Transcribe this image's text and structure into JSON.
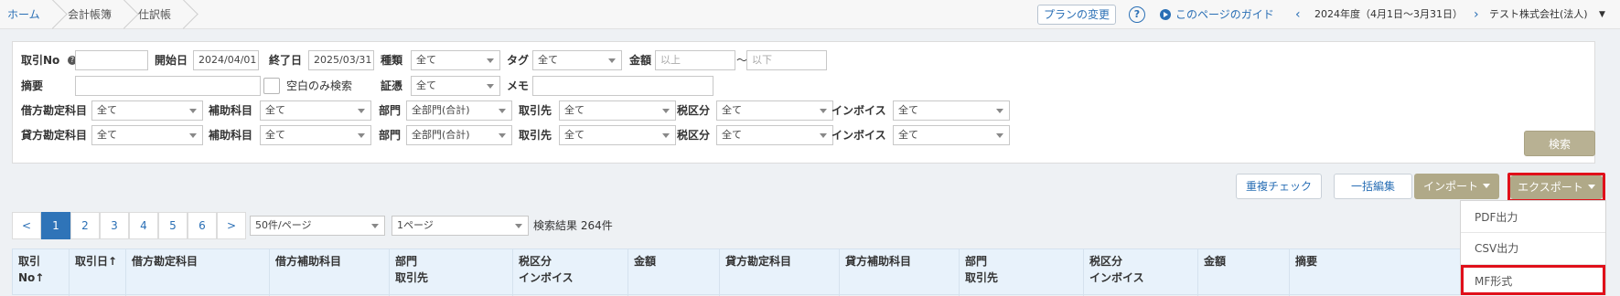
{
  "breadcrumb": [
    "ホーム",
    "会計帳簿",
    "仕訳帳"
  ],
  "header": {
    "plan_button": "プランの変更",
    "help": "?",
    "guide_link": "このページのガイド",
    "fiscal_year": "2024年度（4月1日〜3月31日）",
    "company": "テスト株式会社(法人)"
  },
  "filters": {
    "txn_no_label": "取引No",
    "start_label": "開始日",
    "start_value": "2024/04/01",
    "end_label": "終了日",
    "end_value": "2025/03/31",
    "type_label": "種類",
    "type_value": "全て",
    "tag_label": "タグ",
    "tag_value": "全て",
    "amount_label": "金額",
    "amount_min_ph": "以上",
    "amount_tilde": "〜",
    "amount_max_ph": "以下",
    "summary_label": "摘要",
    "blank_only": "空白のみ検索",
    "voucher_label": "証憑",
    "voucher_value": "全て",
    "memo_label": "メモ",
    "debit_account_label": "借方勘定科目",
    "credit_account_label": "貸方勘定科目",
    "sub_account_label": "補助科目",
    "dept_label": "部門",
    "partner_label": "取引先",
    "tax_label": "税区分",
    "invoice_label": "インボイス",
    "all": "全て",
    "all_dept": "全部門(合計)",
    "search_button": "検索"
  },
  "actions": {
    "dup_check": "重複チェック",
    "bulk_edit": "一括編集",
    "import": "インポート",
    "export": "エクスポート"
  },
  "export_menu": [
    "PDF出力",
    "CSV出力",
    "MF形式"
  ],
  "pagination": {
    "prev": "<",
    "next": ">",
    "pages": [
      "1",
      "2",
      "3",
      "4",
      "5",
      "6"
    ],
    "per_page": "50件/ページ",
    "page_select": "1ページ",
    "result": "検索結果 264件"
  },
  "table": {
    "headers": [
      {
        "l1": "取引No↑",
        "l2": ""
      },
      {
        "l1": "取引日↑",
        "l2": ""
      },
      {
        "l1": "借方勘定科目",
        "l2": ""
      },
      {
        "l1": "借方補助科目",
        "l2": ""
      },
      {
        "l1": "部門",
        "l2": "取引先"
      },
      {
        "l1": "税区分",
        "l2": "インボイス"
      },
      {
        "l1": "金額",
        "l2": ""
      },
      {
        "l1": "貸方勘定科目",
        "l2": ""
      },
      {
        "l1": "貸方補助科目",
        "l2": ""
      },
      {
        "l1": "部門",
        "l2": "取引先"
      },
      {
        "l1": "税区分",
        "l2": "インボイス"
      },
      {
        "l1": "金額",
        "l2": ""
      },
      {
        "l1": "摘要",
        "l2": ""
      }
    ]
  }
}
